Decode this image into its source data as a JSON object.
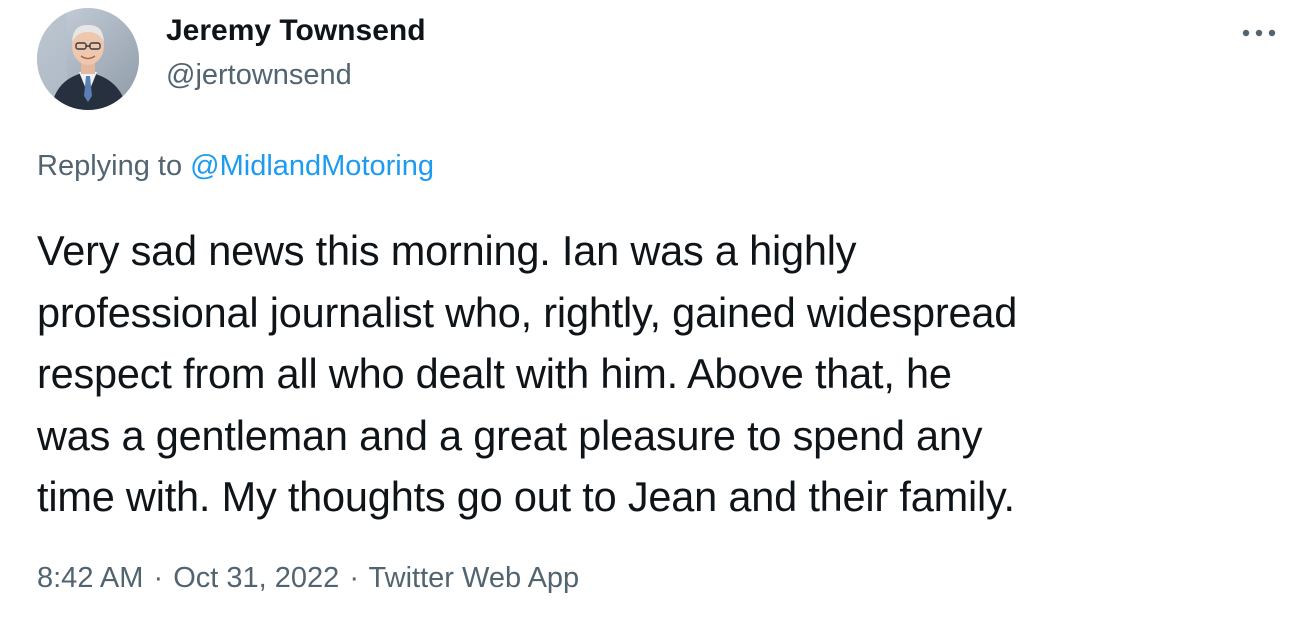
{
  "author": {
    "display_name": "Jeremy Townsend",
    "handle": "@jertownsend",
    "avatar_icon": "profile-photo"
  },
  "reply": {
    "prefix": "Replying to ",
    "mention": "@MidlandMotoring"
  },
  "tweet": {
    "text": "Very sad news this morning.  Ian was a highly\nprofessional journalist who, rightly, gained widespread\nrespect from all who dealt with him.  Above that, he\nwas a gentleman and a great pleasure to spend any\ntime with.  My thoughts go out to Jean and their family."
  },
  "meta": {
    "time": "8:42 AM",
    "date": "Oct 31, 2022",
    "source": "Twitter Web App",
    "separator": "·"
  },
  "icons": {
    "more": "more-options-icon"
  },
  "colors": {
    "text": "#0f1419",
    "secondary": "#536471",
    "link": "#1d9bf0"
  }
}
